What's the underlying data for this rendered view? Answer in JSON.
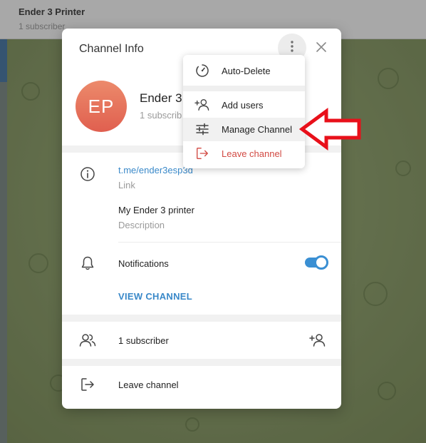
{
  "background_app": {
    "chat_title": "Ender 3 Printer",
    "chat_subtitle": "1 subscriber"
  },
  "modal": {
    "title": "Channel Info",
    "more_icon": "more-vertical-icon",
    "close_icon": "close-icon",
    "avatar_initials": "EP",
    "channel_name": "Ender 3",
    "channel_subtitle": "1 subscrib",
    "link_value": "t.me/ender3esp3d",
    "link_label": "Link",
    "description_value": "My Ender 3 printer",
    "description_label": "Description",
    "notifications_label": "Notifications",
    "notifications_enabled": true,
    "view_channel_label": "VIEW CHANNEL",
    "subscribers_label": "1 subscriber",
    "leave_label": "Leave channel"
  },
  "menu": {
    "items": [
      {
        "label": "Auto-Delete",
        "icon": "timer-icon"
      },
      {
        "label": "Add users",
        "icon": "add-user-icon"
      },
      {
        "label": "Manage Channel",
        "icon": "sliders-icon"
      },
      {
        "label": "Leave channel",
        "icon": "leave-icon"
      }
    ]
  },
  "colors": {
    "accent": "#3a89c9",
    "danger": "#d24a43",
    "annotation_arrow": "#e8101a",
    "avatar_top": "#ec8a6b",
    "avatar_bottom": "#e05f4f"
  }
}
